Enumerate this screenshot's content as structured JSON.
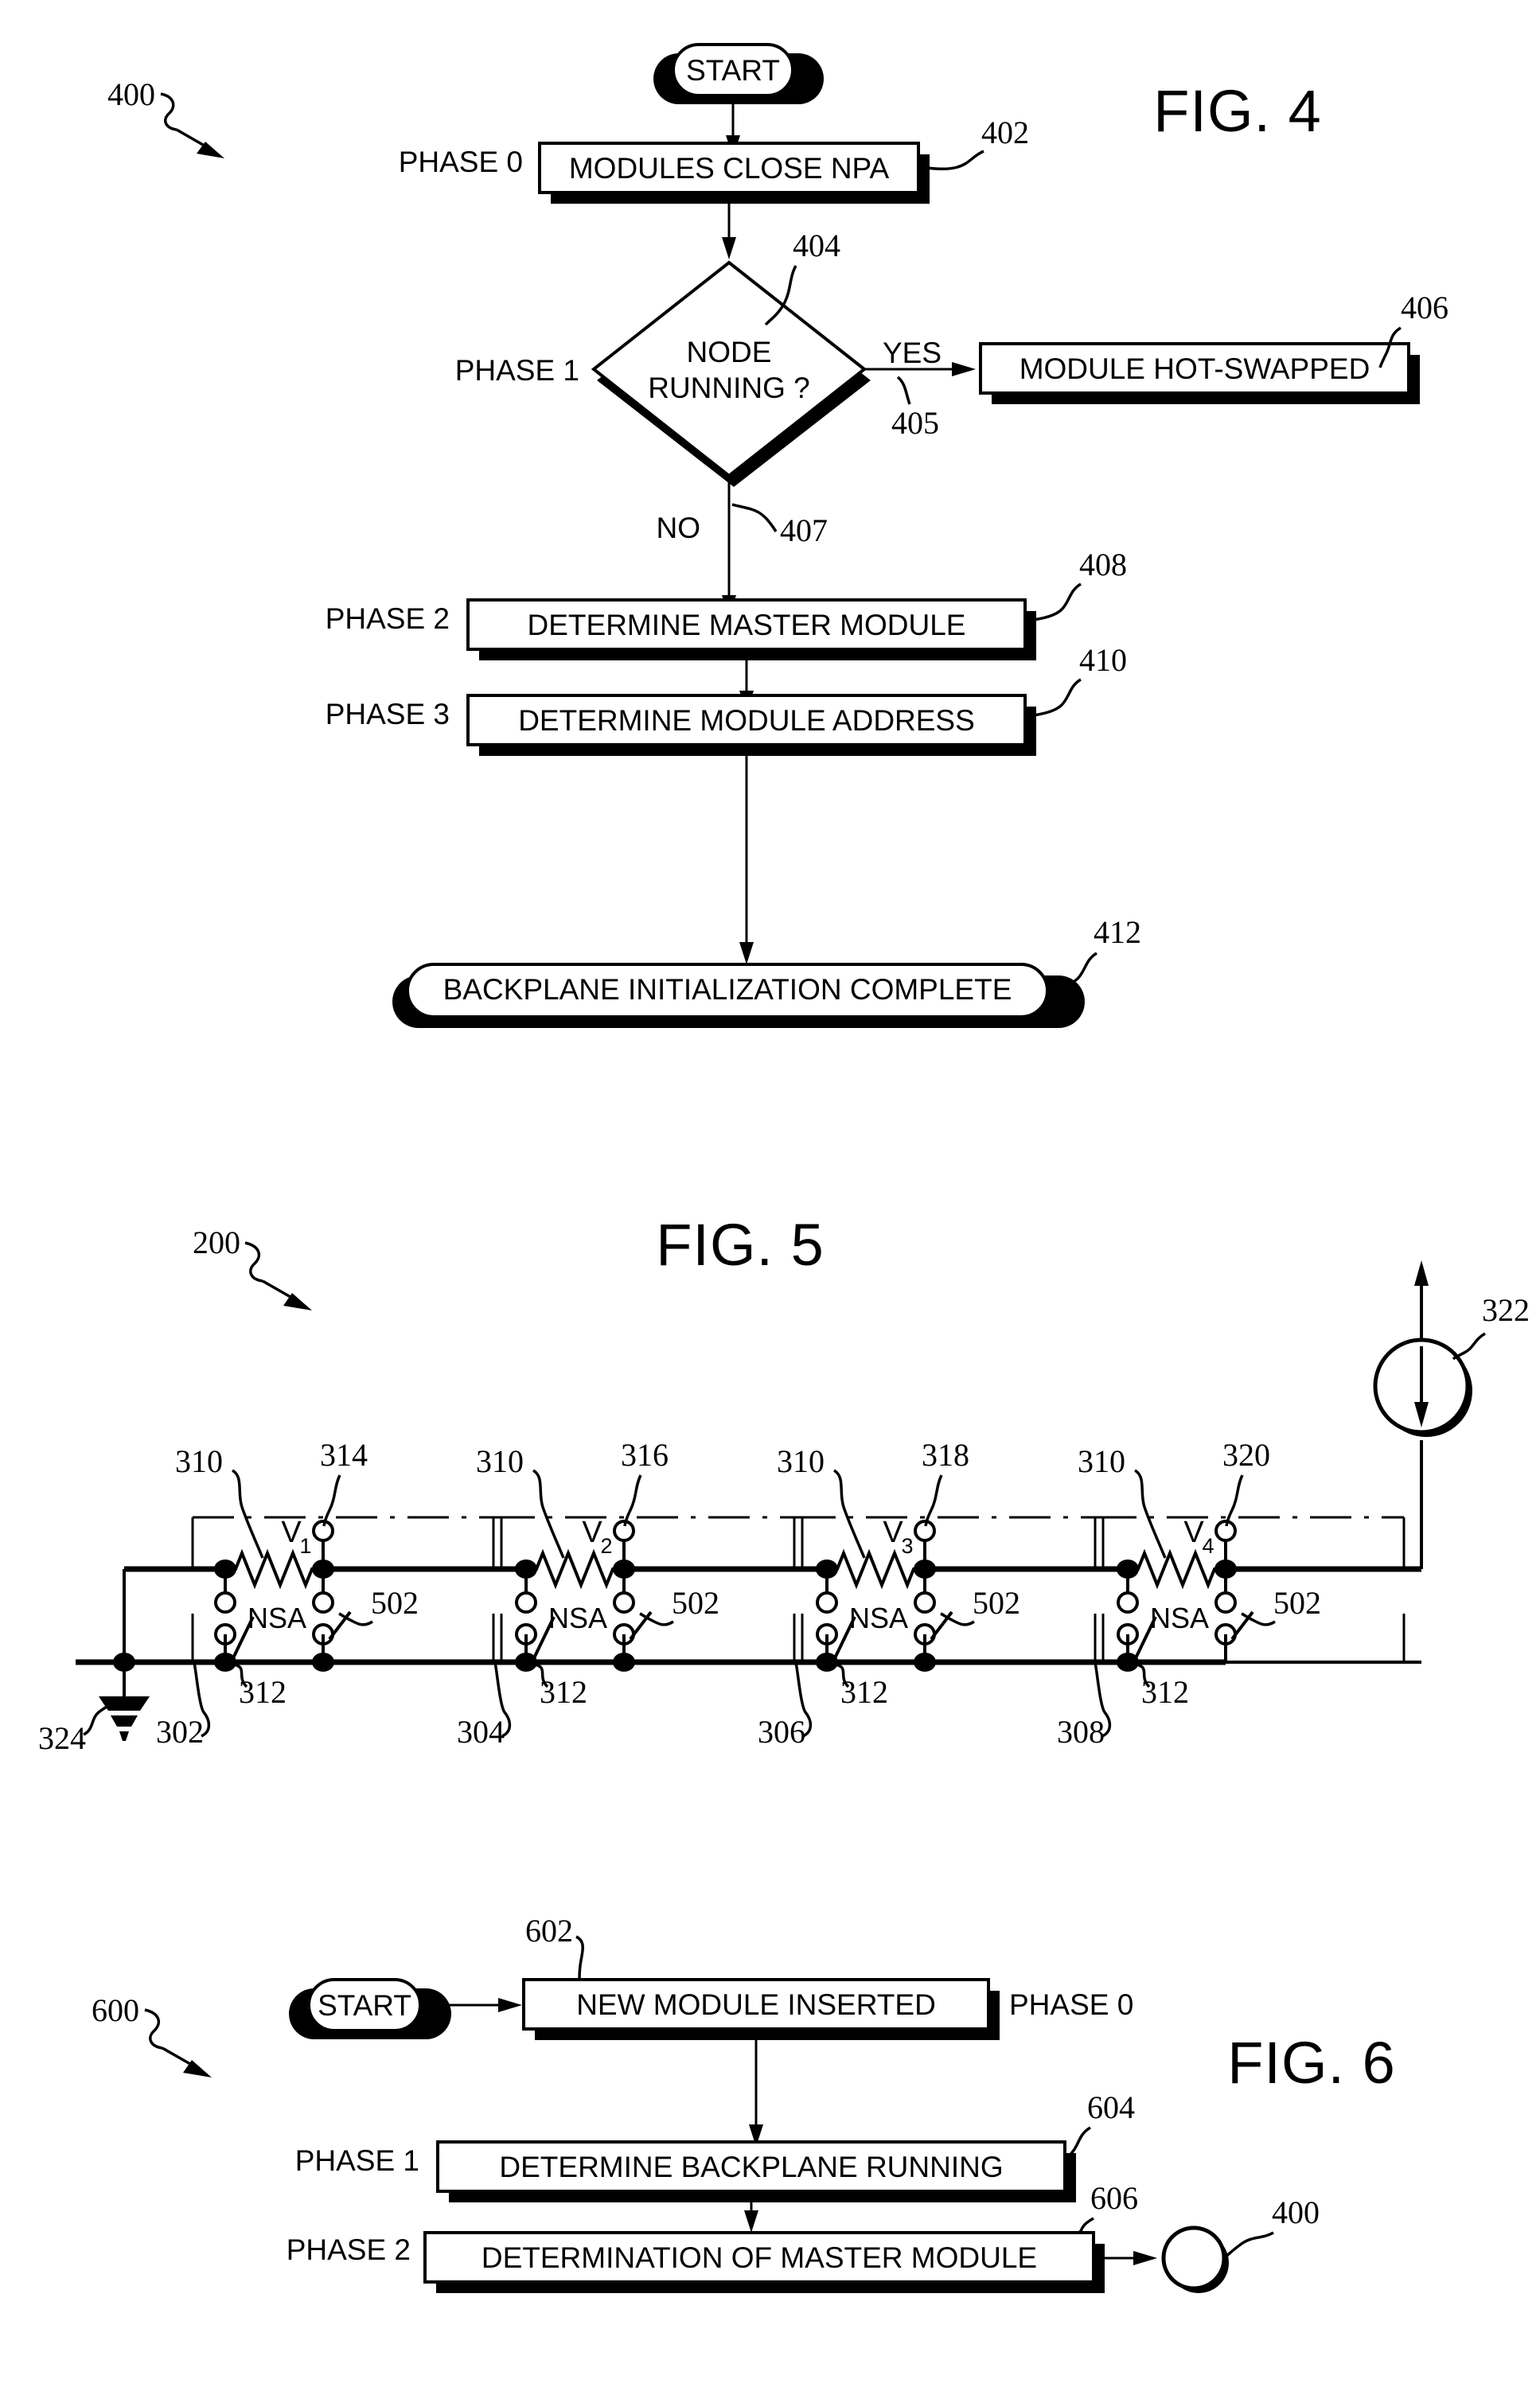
{
  "sheet": {
    "figures": [
      "FIG. 4",
      "FIG. 5",
      "FIG. 6"
    ]
  },
  "fig4": {
    "title": "FIG. 4",
    "ref": "400",
    "start_label": "START",
    "phases": [
      {
        "label": "PHASE 0"
      },
      {
        "label": "PHASE 1"
      },
      {
        "label": "PHASE 2"
      },
      {
        "label": "PHASE 3"
      }
    ],
    "steps": [
      {
        "ref": "402",
        "text": "MODULES CLOSE NPA",
        "phase": "PHASE 0"
      },
      {
        "ref": "404",
        "text_line1": "NODE",
        "text_line2": "RUNNING ?",
        "phase": "PHASE 1"
      },
      {
        "ref": "406",
        "text": "MODULE HOT-SWAPPED"
      },
      {
        "ref": "408",
        "text": "DETERMINE MASTER MODULE",
        "phase": "PHASE 2"
      },
      {
        "ref": "410",
        "text": "DETERMINE MODULE ADDRESS",
        "phase": "PHASE 3"
      },
      {
        "ref": "412",
        "text": "BACKPLANE INITIALIZATION COMPLETE"
      }
    ],
    "branch_yes": "YES",
    "branch_yes_ref": "405",
    "branch_no": "NO",
    "branch_no_ref": "407"
  },
  "fig5": {
    "title": "FIG. 5",
    "ref": "200",
    "ground_ref": "324",
    "source_ref": "322",
    "modules": [
      {
        "ref": "302",
        "resistor_ref": "310",
        "switch_ref": "312",
        "tap_ref": "314",
        "node_ref": "502",
        "voltage": "V",
        "voltage_sub": "1",
        "label": "NSA"
      },
      {
        "ref": "304",
        "resistor_ref": "310",
        "switch_ref": "312",
        "tap_ref": "316",
        "node_ref": "502",
        "voltage": "V",
        "voltage_sub": "2",
        "label": "NSA"
      },
      {
        "ref": "306",
        "resistor_ref": "310",
        "switch_ref": "312",
        "tap_ref": "318",
        "node_ref": "502",
        "voltage": "V",
        "voltage_sub": "3",
        "label": "NSA"
      },
      {
        "ref": "308",
        "resistor_ref": "310",
        "switch_ref": "312",
        "tap_ref": "320",
        "node_ref": "502",
        "voltage": "V",
        "voltage_sub": "4",
        "label": "NSA"
      }
    ]
  },
  "fig6": {
    "title": "FIG. 6",
    "ref": "600",
    "start_label": "START",
    "exit_ref": "400",
    "steps": [
      {
        "ref": "602",
        "text": "NEW MODULE INSERTED",
        "phase": "PHASE 0",
        "phase_side": "right"
      },
      {
        "ref": "604",
        "text": "DETERMINE BACKPLANE RUNNING",
        "phase": "PHASE 1",
        "phase_side": "left"
      },
      {
        "ref": "606",
        "text": "DETERMINATION OF MASTER MODULE",
        "phase": "PHASE 2",
        "phase_side": "left"
      }
    ]
  },
  "colors": {
    "ink": "#000000",
    "paper": "#ffffff"
  }
}
